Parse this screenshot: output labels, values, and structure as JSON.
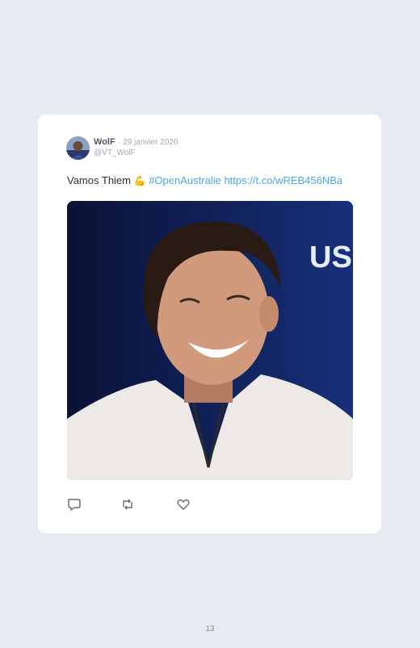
{
  "tweet": {
    "author_name": "WolF",
    "separator": "·",
    "date": "29 janvier 2020",
    "handle": "@VT_WolF",
    "text_prefix": "Vamos Thiem",
    "emoji": "💪",
    "hashtag": "#OpenAustralie",
    "url": "https://t.co/wREB456NBa",
    "media_logo_text": "US"
  },
  "icons": {
    "reply": "reply-icon",
    "retweet": "retweet-icon",
    "like": "heart-icon"
  },
  "colors": {
    "background": "#e7eaf1",
    "card": "#ffffff",
    "link": "#4aa8e0",
    "icon": "#5a6b7d"
  },
  "page": {
    "number": "13"
  }
}
